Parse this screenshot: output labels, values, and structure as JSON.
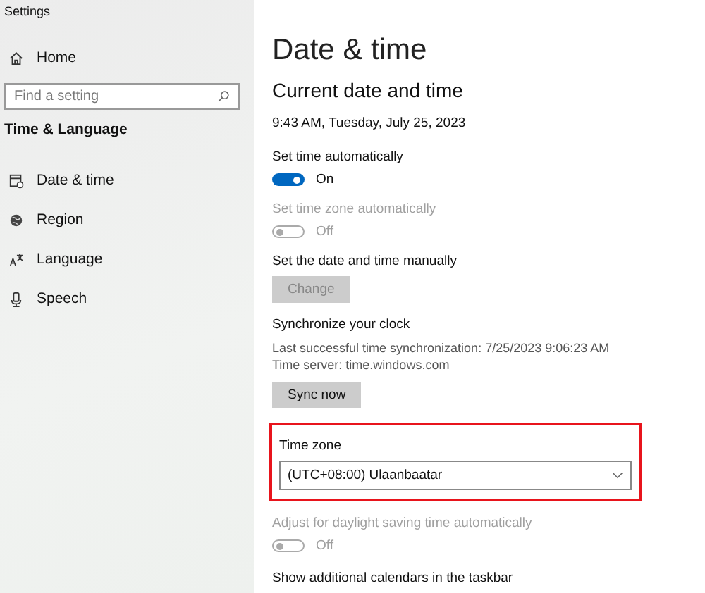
{
  "window": {
    "title": "Settings"
  },
  "sidebar": {
    "home": "Home",
    "search": {
      "placeholder": "Find a setting"
    },
    "section": "Time & Language",
    "items": [
      {
        "label": "Date & time",
        "selected": false
      },
      {
        "label": "Region",
        "selected": false
      },
      {
        "label": "Language",
        "selected": false
      },
      {
        "label": "Speech",
        "selected": false
      }
    ]
  },
  "main": {
    "title": "Date & time",
    "subtitle": "Current date and time",
    "current_time": "9:43 AM, Tuesday, July 25, 2023",
    "settings": [
      {
        "kind": "toggle",
        "label": "Set time automatically",
        "on": true,
        "disabled": false,
        "state_text": "On"
      },
      {
        "kind": "toggle",
        "label": "Set time zone automatically",
        "on": false,
        "disabled": true,
        "state_text": "Off"
      },
      {
        "kind": "button",
        "label": "Set the date and time manually",
        "button": "Change",
        "disabled": true
      },
      {
        "kind": "sync",
        "label": "Synchronize your clock",
        "lines": [
          "Last successful time synchronization: 7/25/2023 9:06:23 AM",
          "Time server: time.windows.com"
        ],
        "button": "Sync now",
        "disabled": false
      },
      {
        "kind": "dropdown",
        "label": "Time zone",
        "value": "(UTC+08:00) Ulaanbaatar",
        "highlighted": true
      },
      {
        "kind": "toggle",
        "label": "Adjust for daylight saving time automatically",
        "on": false,
        "disabled": true,
        "state_text": "Off"
      },
      {
        "kind": "heading",
        "label": "Show additional calendars in the taskbar"
      }
    ]
  }
}
